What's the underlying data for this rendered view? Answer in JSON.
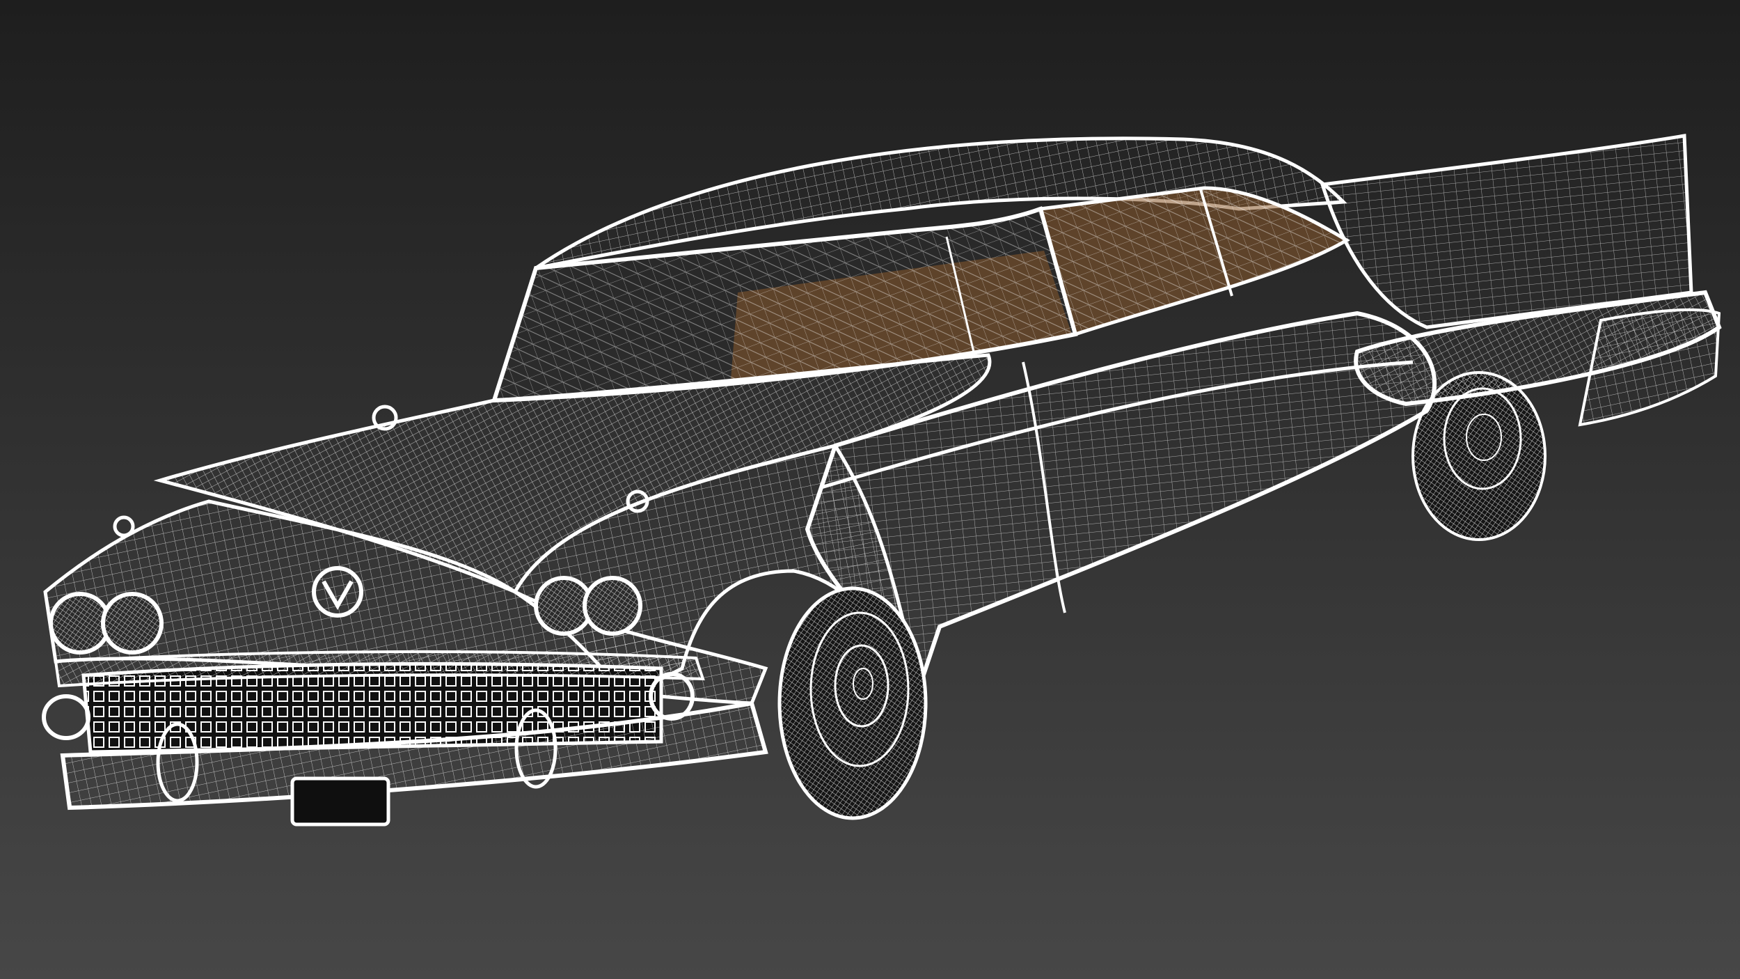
{
  "scene": {
    "subject": "wireframe-classic-car",
    "render_mode": "wireframe",
    "colors": {
      "background_top": "#1e1e1e",
      "background_bottom": "#474747",
      "wire": "#ffffff",
      "wire_dense": "#cfcfcf",
      "interior": "#8a5a2b",
      "glass_dark": "#2a2a2a",
      "plate": "#0f0f0f",
      "tire_shadow": "#151515"
    }
  }
}
